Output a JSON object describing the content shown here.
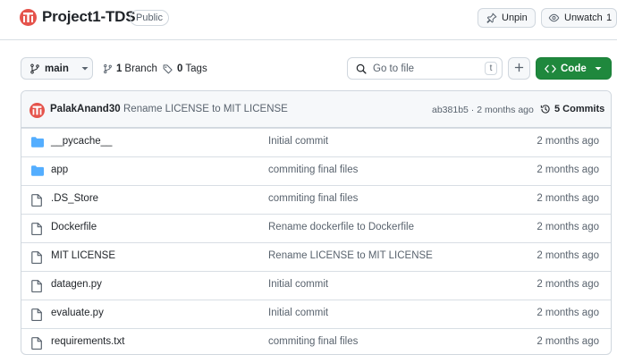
{
  "repo": {
    "name": "Project1-TDS",
    "visibility": "Public"
  },
  "actions": {
    "unpin_label": "Unpin",
    "unwatch_label": "Unwatch",
    "watch_count": "1"
  },
  "toolbar": {
    "branch_selector": "main",
    "branch_count": "1",
    "branch_label": "Branch",
    "tag_count": "0",
    "tag_label": "Tags",
    "search_placeholder": "Go to file",
    "search_shortcut": "t",
    "add_label": "+",
    "code_label": "Code"
  },
  "latest_commit": {
    "author": "PalakAnand30",
    "message": "Rename LICENSE to MIT LICENSE",
    "hash_and_time": "ab381b5 · 2 months ago",
    "commits_label": "5 Commits"
  },
  "files": [
    {
      "type": "folder",
      "name": "__pycache__",
      "message": "Initial commit",
      "age": "2 months ago"
    },
    {
      "type": "folder",
      "name": "app",
      "message": "commiting final files",
      "age": "2 months ago"
    },
    {
      "type": "file",
      "name": ".DS_Store",
      "message": "commiting final files",
      "age": "2 months ago"
    },
    {
      "type": "file",
      "name": "Dockerfile",
      "message": "Rename dockerfile to Dockerfile",
      "age": "2 months ago"
    },
    {
      "type": "file",
      "name": "MIT LICENSE",
      "message": "Rename LICENSE to MIT LICENSE",
      "age": "2 months ago"
    },
    {
      "type": "file",
      "name": "datagen.py",
      "message": "Initial commit",
      "age": "2 months ago"
    },
    {
      "type": "file",
      "name": "evaluate.py",
      "message": "Initial commit",
      "age": "2 months ago"
    },
    {
      "type": "file",
      "name": "requirements.txt",
      "message": "commiting final files",
      "age": "2 months ago"
    }
  ],
  "colors": {
    "folder": "#54aeff",
    "code_button": "#1f883d",
    "avatar": "#e5534b"
  }
}
